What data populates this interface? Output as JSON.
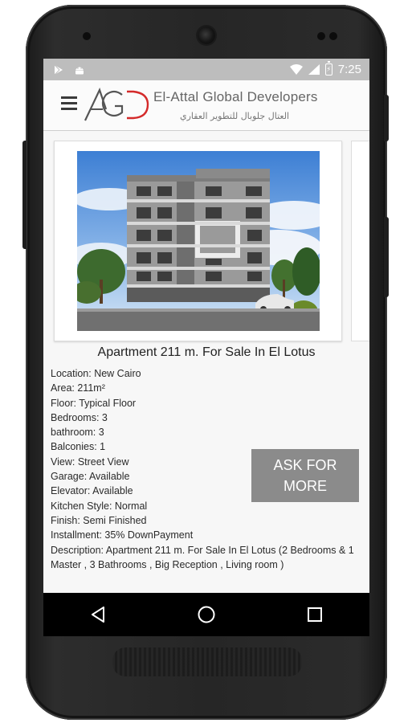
{
  "status_bar": {
    "time": "7:25",
    "left_icons": [
      "play-store-icon",
      "android-icon"
    ],
    "right_icons": [
      "wifi-icon",
      "signal-icon",
      "battery-charging-icon"
    ]
  },
  "app_bar": {
    "menu_icon": "hamburger-menu-icon",
    "logo_text": "AGD",
    "brand_name": "El-Attal Global Developers",
    "brand_arabic": "العتال جلوبال للتطوير العقاري"
  },
  "listing": {
    "title": "Apartment 211 m. For Sale In El Lotus",
    "details": [
      "Location: New Cairo",
      "Area: 211m²",
      "Floor: Typical Floor",
      "Bedrooms: 3",
      "bathroom: 3",
      "Balconies: 1",
      "View: Street View",
      "Garage: Available",
      "Elevator: Available",
      "Kitchen Style: Normal",
      "Finish: Semi Finished",
      "Installment: 35% DownPayment"
    ],
    "description": "Description:  Apartment 211 m. For Sale In El Lotus  (2 Bedrooms & 1 Master , 3 Bathrooms , Big Reception , Living room )",
    "ask_button": "ASK FOR MORE"
  },
  "navigation": {
    "back_icon": "back-triangle-icon",
    "home_icon": "home-circle-icon",
    "recents_icon": "recents-square-icon"
  },
  "colors": {
    "status_bar": "#bdbdbd",
    "ask_button": "#8b8b8b",
    "logo_red": "#d42a2a",
    "logo_gray": "#555555",
    "nav_bar": "#000000"
  }
}
